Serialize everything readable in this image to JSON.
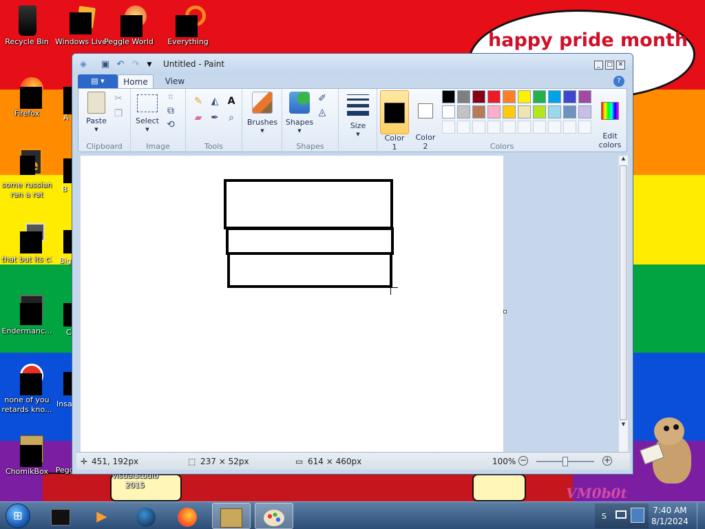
{
  "desktop": {
    "cloud_text": "happy pride month",
    "watermark": "VM0b0t",
    "icons": [
      {
        "label": "Recycle Bin",
        "icon": "recycle-bin-icon"
      },
      {
        "label": "Windows Live",
        "icon": "windows-live-icon"
      },
      {
        "label": "Peggle World",
        "icon": "peggle-world-icon"
      },
      {
        "label": "Everything",
        "icon": "everything-search-icon"
      },
      {
        "label": "Firefox",
        "icon": "firefox-icon"
      },
      {
        "label": "some russian ran a rat",
        "icon": "document-icon"
      },
      {
        "label": "that but its c#",
        "icon": "folder-icon"
      },
      {
        "label": "Endermanc...",
        "icon": "app-icon"
      },
      {
        "label": "none of you retards kno...",
        "icon": "app-icon"
      },
      {
        "label": "ChomikBox",
        "icon": "chomikbox-icon"
      },
      {
        "label": "Peggle Deluxe",
        "icon": "peggle-deluxe-icon"
      },
      {
        "label": "VisualStudio 2015",
        "icon": "visual-studio-icon"
      }
    ],
    "partial_labels": [
      "A",
      "B",
      "Big",
      "C",
      "Insa"
    ],
    "rainbow_colors": [
      "#e60e17",
      "#ff8c00",
      "#ffec00",
      "#00a541",
      "#0a4fd9",
      "#7b1ea2"
    ]
  },
  "window": {
    "title": "Untitled - Paint",
    "tabs": [
      {
        "label": "Home"
      },
      {
        "label": "View"
      }
    ],
    "groups": {
      "clipboard": {
        "label": "Clipboard",
        "paste": "Paste"
      },
      "image": {
        "label": "Image",
        "select": "Select"
      },
      "tools": {
        "label": "Tools"
      },
      "brushes": {
        "label": "Brushes"
      },
      "shapes": {
        "label": "Shapes",
        "shapes": "Shapes"
      },
      "size": {
        "label": "Size"
      },
      "colors": {
        "label": "Colors",
        "color1": "Color\n1",
        "color2": "Color\n2",
        "edit": "Edit\ncolors",
        "color1_value": "#000000",
        "color2_value": "#ffffff",
        "palette_row1": [
          "#000000",
          "#7f7f7f",
          "#880015",
          "#ed1c24",
          "#ff7f27",
          "#fff200",
          "#22b14c",
          "#00a2e8",
          "#3f48cc",
          "#a349a4"
        ],
        "palette_row2": [
          "#ffffff",
          "#c3c3c3",
          "#b97a57",
          "#ffaec9",
          "#ffc90e",
          "#efe4b0",
          "#b5e61d",
          "#99d9ea",
          "#7092be",
          "#c8bfe7"
        ]
      }
    },
    "status": {
      "cursor": "451, 192px",
      "selection": "237 × 52px",
      "canvas_size": "614 × 460px",
      "zoom": "100%",
      "zoom_fraction": 0.5
    }
  },
  "taskbar": {
    "time": "7:40 AM",
    "date": "8/1/2024",
    "tray_text": "S"
  }
}
